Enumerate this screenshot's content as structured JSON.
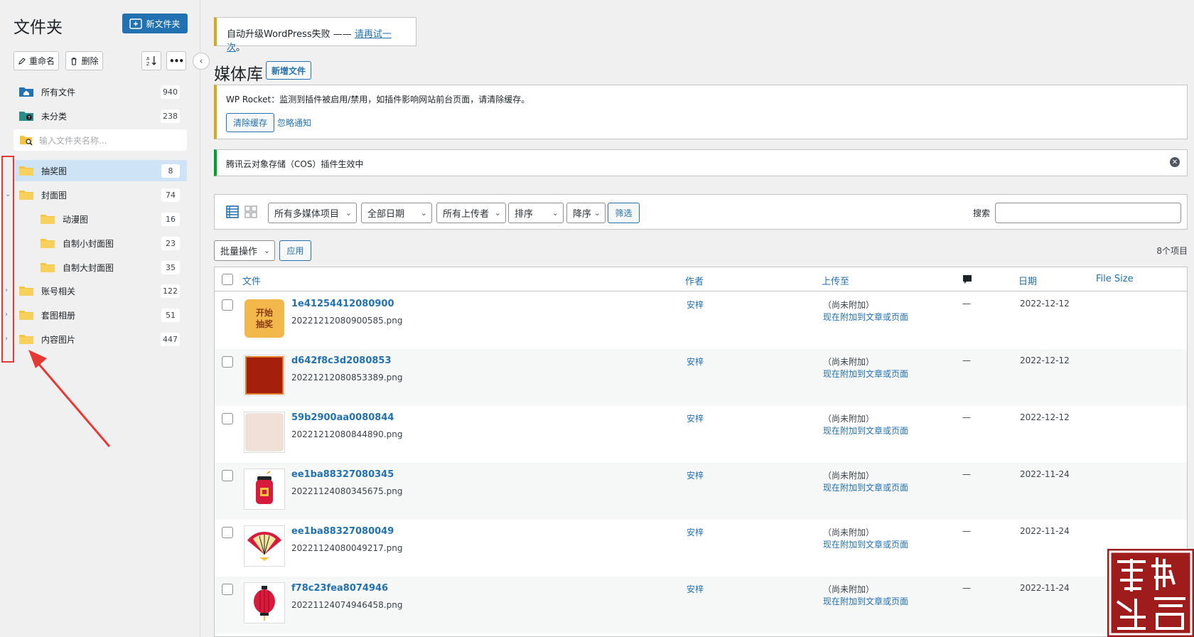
{
  "sidebar": {
    "title": "文件夹",
    "new_folder_label": "新文件夹",
    "rename_label": "重命名",
    "delete_label": "删除",
    "more_label": "•••",
    "search_placeholder": "输入文件夹名称...",
    "all_files": {
      "label": "所有文件",
      "count": "940"
    },
    "uncategorized": {
      "label": "未分类",
      "count": "238"
    },
    "folders": [
      {
        "label": "抽奖图",
        "count": "8",
        "active": true
      },
      {
        "label": "封面图",
        "count": "74",
        "expanded": true
      },
      {
        "label": "动漫图",
        "count": "16"
      },
      {
        "label": "自制小封面图",
        "count": "23"
      },
      {
        "label": "自制大封面图",
        "count": "35"
      },
      {
        "label": "账号相关",
        "count": "122"
      },
      {
        "label": "套图相册",
        "count": "51"
      },
      {
        "label": "内容图片",
        "count": "447"
      }
    ]
  },
  "notices": {
    "upgrade_text": "自动升级WordPress失败 —— ",
    "upgrade_link": "请再试一次",
    "upgrade_tail": "。",
    "rocket_text": "WP Rocket：监测到插件被启用/禁用，如插件影响网站前台页面，请清除缓存。",
    "rocket_clear": "清除缓存",
    "rocket_ignore": "忽略通知",
    "cos_text": "腾讯云对象存储（COS）插件生效中"
  },
  "page": {
    "title": "媒体库",
    "add_new": "新增文件"
  },
  "filters": {
    "media_type": "所有多媒体项目",
    "date": "全部日期",
    "uploader": "所有上传者",
    "orderby": "排序",
    "order": "降序",
    "filter_btn": "筛选",
    "search_label": "搜索"
  },
  "bulk": {
    "action": "批量操作",
    "apply": "应用",
    "items_count": "8个项目"
  },
  "table": {
    "headers": {
      "file": "文件",
      "author": "作者",
      "uploaded_to": "上传至",
      "date": "日期",
      "size": "File Size"
    },
    "rows": [
      {
        "title": "1e41254412080900",
        "file": "20221212080900585.png",
        "author": "安梓",
        "unattached": "（尚未附加）",
        "attach": "现在附加到文章或页面",
        "comments": "—",
        "date": "2022-12-12",
        "thumb_text": "开始\n抽奖"
      },
      {
        "title": "d642f8c3d2080853",
        "file": "20221212080853389.png",
        "author": "安梓",
        "unattached": "（尚未附加）",
        "attach": "现在附加到文章或页面",
        "comments": "—",
        "date": "2022-12-12"
      },
      {
        "title": "59b2900aa0080844",
        "file": "20221212080844890.png",
        "author": "安梓",
        "unattached": "（尚未附加）",
        "attach": "现在附加到文章或页面",
        "comments": "—",
        "date": "2022-12-12"
      },
      {
        "title": "ee1ba88327080345",
        "file": "20221124080345675.png",
        "author": "安梓",
        "unattached": "（尚未附加）",
        "attach": "现在附加到文章或页面",
        "comments": "—",
        "date": "2022-11-24"
      },
      {
        "title": "ee1ba88327080049",
        "file": "20221124080049217.png",
        "author": "安梓",
        "unattached": "（尚未附加）",
        "attach": "现在附加到文章或页面",
        "comments": "—",
        "date": "2022-11-24"
      },
      {
        "title": "f78c23fea8074946",
        "file": "20221124074946458.png",
        "author": "安梓",
        "unattached": "（尚未附加）",
        "attach": "现在附加到文章或页面",
        "comments": "—",
        "date": "2022-11-24"
      }
    ]
  },
  "seal": {
    "text": "岁月安生"
  },
  "colors": {
    "accent": "#2271b1",
    "warning": "#dba617",
    "success": "#00a32a",
    "annotation": "#e53935",
    "active_folder": "#cfe3f7"
  }
}
